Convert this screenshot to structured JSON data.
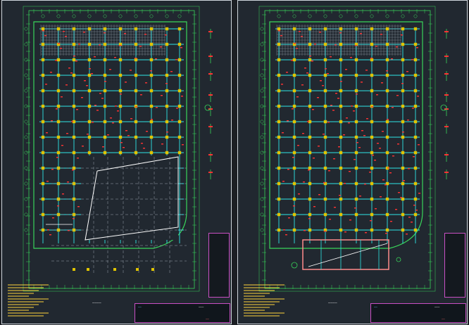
{
  "drawing": {
    "colors": {
      "background": "#212830",
      "border": "#cfd6dd",
      "grid_axis": "#39d45a",
      "beam": "#2fe6e6",
      "column": "#e0c400",
      "rebar": "#ff3333",
      "notes": "#ffd43b",
      "table": "#c94fc4",
      "white_line": "#ffffff"
    },
    "sheets": [
      {
        "caption": "————",
        "title_block": {
          "title": "———",
          "firm": "——",
          "drawing_no": "——"
        }
      },
      {
        "caption": "————",
        "title_block": {
          "title": "———",
          "firm": "——",
          "drawing_no": "——"
        }
      }
    ]
  }
}
